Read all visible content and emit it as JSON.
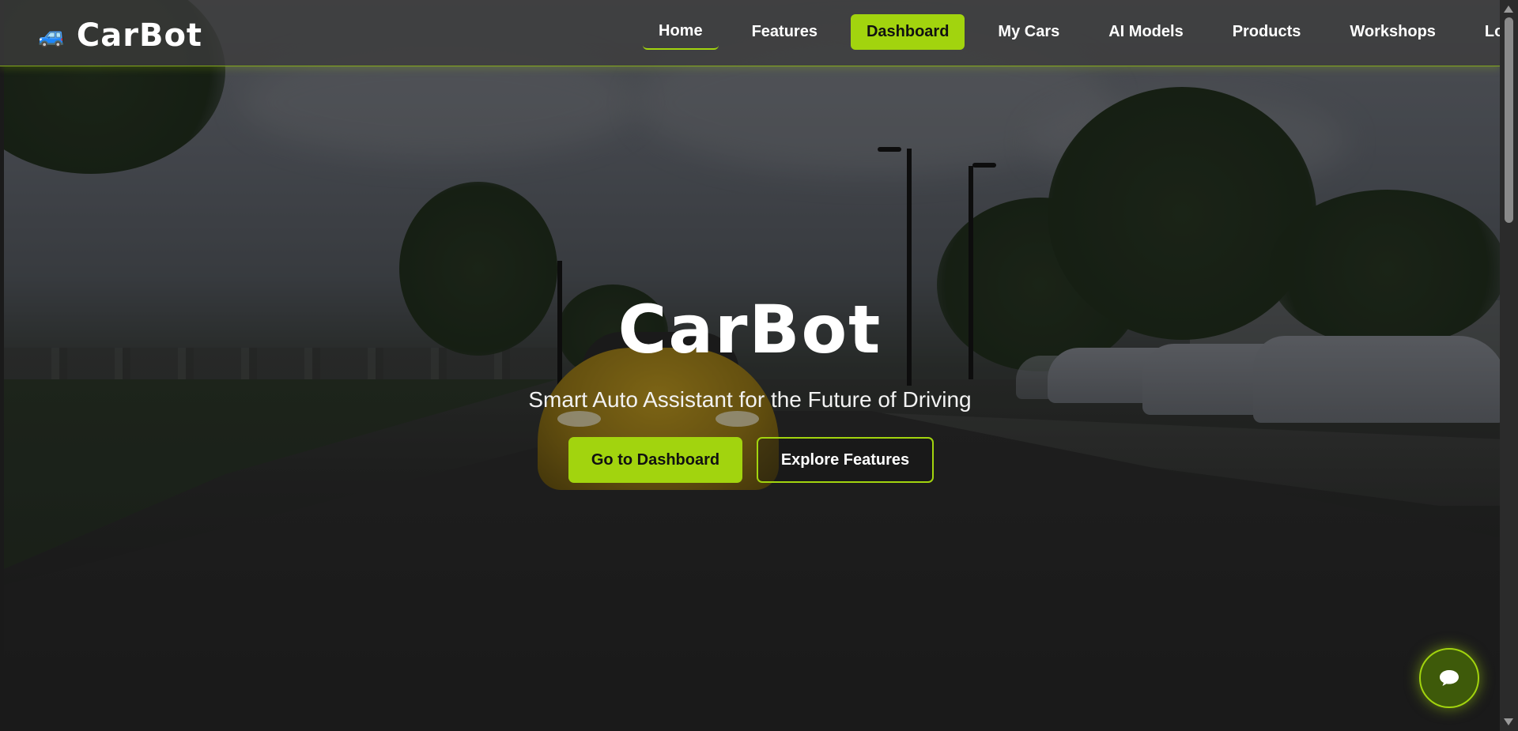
{
  "brand": {
    "icon": "car-icon",
    "name": "CarBot"
  },
  "nav": {
    "items": [
      {
        "label": "Home"
      },
      {
        "label": "Features"
      },
      {
        "label": "Dashboard"
      },
      {
        "label": "My Cars"
      },
      {
        "label": "AI Models"
      },
      {
        "label": "Products"
      },
      {
        "label": "Workshops"
      },
      {
        "label": "Log"
      }
    ],
    "active": "Dashboard"
  },
  "hero": {
    "title": "CarBot",
    "subtitle": "Smart Auto Assistant for the Future of Driving",
    "primary_button": "Go to Dashboard",
    "secondary_button": "Explore Features"
  },
  "chat": {
    "icon": "chat-bubble-icon"
  },
  "colors": {
    "accent": "#a2d40e",
    "navbar": "#3c3c3c",
    "text": "#ffffff"
  }
}
